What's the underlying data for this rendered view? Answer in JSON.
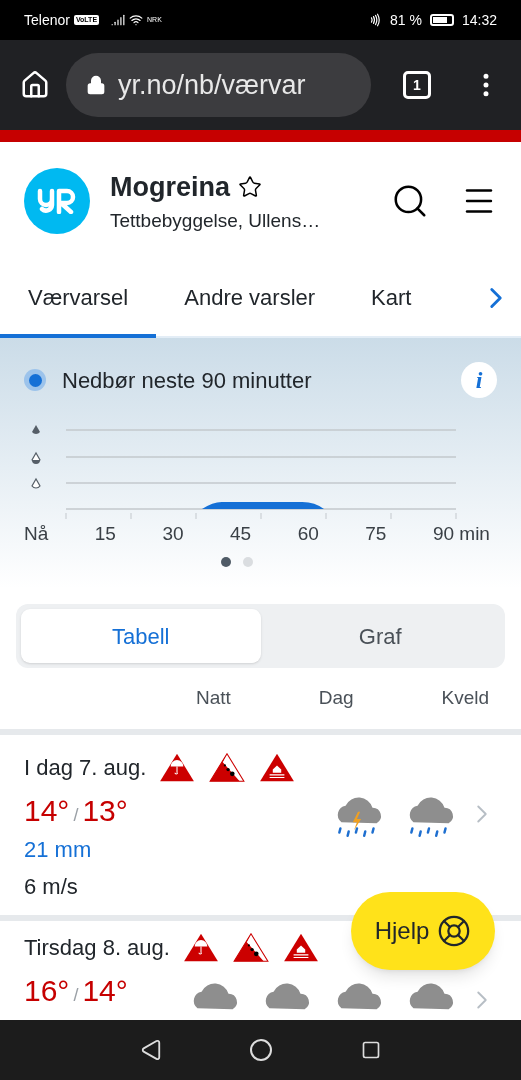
{
  "status_bar": {
    "carrier": "Telenor",
    "volte": "VoLTE",
    "network_badge": "NRK",
    "battery": "81 %",
    "time": "14:32"
  },
  "browser": {
    "url": "yr.no/nb/værvar",
    "tab_count": "1"
  },
  "header": {
    "title": "Mogreina",
    "subtitle": "Tettbebyggelse, Ullens…"
  },
  "tabs": [
    {
      "label": "Værvarsel",
      "selected": true
    },
    {
      "label": "Andre varsler",
      "selected": false
    },
    {
      "label": "Kart",
      "selected": false
    }
  ],
  "nowcast": {
    "title": "Nedbør neste 90 minutter",
    "info_button": "i",
    "x_labels": [
      "Nå",
      "15",
      "30",
      "45",
      "60",
      "75",
      "90 min"
    ],
    "pages": [
      {
        "selected": true
      },
      {
        "selected": false
      }
    ]
  },
  "view_toggle": [
    {
      "label": "Tabell",
      "selected": true
    },
    {
      "label": "Graf",
      "selected": false
    }
  ],
  "columns": [
    "Natt",
    "Dag",
    "Kveld"
  ],
  "days": [
    {
      "date": "I dag 7. aug.",
      "warnings": [
        {
          "kind": "rain"
        },
        {
          "kind": "landslide"
        },
        {
          "kind": "flood"
        }
      ],
      "high": "14°",
      "separator": "/",
      "low": "13°",
      "precipitation": "21 mm",
      "wind": "6 m/s",
      "symbols": [
        {
          "kind": "thunder-rain"
        },
        {
          "kind": "rain"
        }
      ]
    },
    {
      "date": "Tirsdag 8. aug.",
      "warnings": [
        {
          "kind": "rain"
        },
        {
          "kind": "landslide"
        },
        {
          "kind": "flood"
        }
      ],
      "high": "16°",
      "separator": "/",
      "low": "14°",
      "symbols": [
        {
          "kind": "cloud"
        },
        {
          "kind": "cloud"
        },
        {
          "kind": "cloud"
        },
        {
          "kind": "cloud"
        }
      ]
    }
  ],
  "help_button": "Hjelp"
}
